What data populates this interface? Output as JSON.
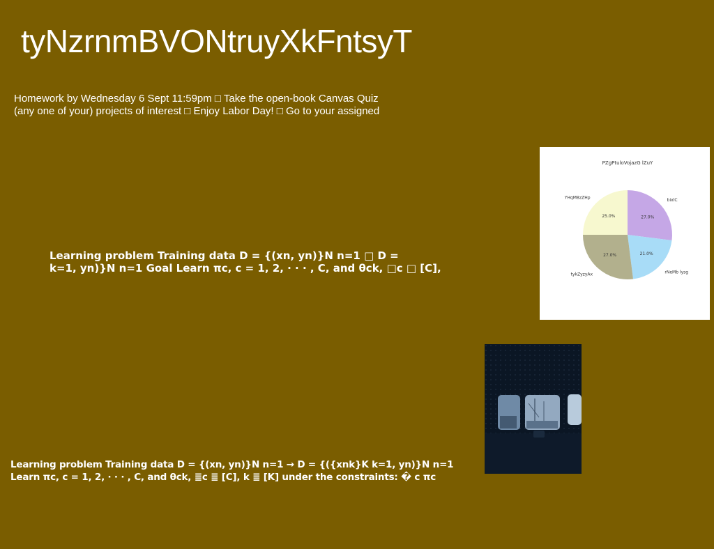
{
  "slide": {
    "title": "tyNzrnmBVONtruyXkFntsyT",
    "homework_lines": [
      "Homework by Wednesday 6 Sept 11:59pm □ Take the open-book Canvas Quiz",
      "(any one of your) projects of interest □ Enjoy Labor Day! □ Go to your assigned"
    ],
    "learning_block_1": [
      "Learning problem Training data D = {(xn, yn)}N n=1 □ D =",
      "k=1, yn)}N n=1 Goal Learn πc, c = 1, 2, · · · , C, and θck, □c □ [C],"
    ],
    "learning_block_2": [
      "Learning problem Training data D = {(xn, yn)}N n=1 → D = {({xnk}K k=1, yn)}N n=1",
      "Learn πc, c = 1, 2, · · · , C, and θck, ≣c ≣ [C], k ≣ [K] under the constraints: � c πc"
    ],
    "background_color": "#7a5d00"
  },
  "chart_data": {
    "type": "pie",
    "title": "PZgPtuloVojazG lZuY",
    "start_angle_deg": 90,
    "direction": "clockwise",
    "slices": [
      {
        "label": "bixlC",
        "value": 27.0,
        "pct_label": "27.0%",
        "color": "#c5a7e6"
      },
      {
        "label": "rNeMb lysg",
        "value": 21.0,
        "pct_label": "21.0%",
        "color": "#a8dcf7"
      },
      {
        "label": "tykZyzyAx",
        "value": 27.0,
        "pct_label": "27.0%",
        "color": "#b2b08d"
      },
      {
        "label": "YHqMBzZHp",
        "value": 25.0,
        "pct_label": "25.0%",
        "color": "#f7f8cf"
      }
    ]
  },
  "photo": {
    "icon": "train-window-photo"
  }
}
